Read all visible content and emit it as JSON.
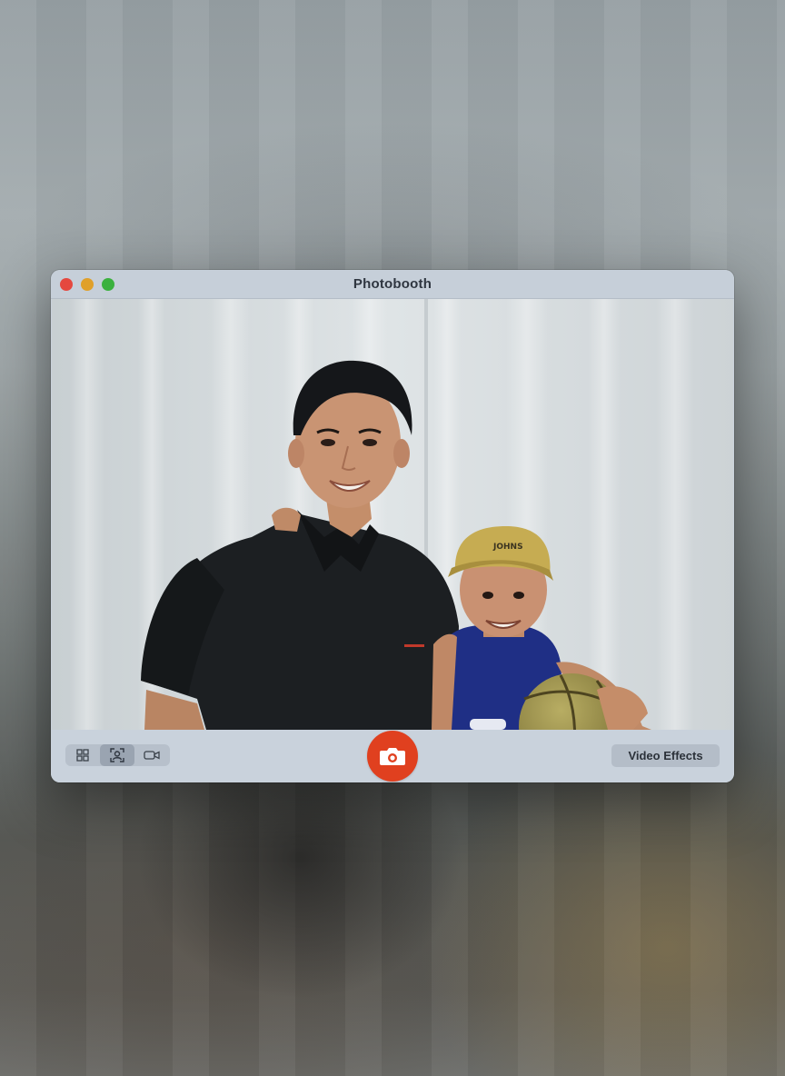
{
  "window": {
    "title": "Photobooth"
  },
  "traffic_lights": {
    "close_color": "#e5483f",
    "minimize_color": "#e0a02a",
    "maximize_color": "#3bb13e"
  },
  "toolbar": {
    "view_modes": [
      {
        "icon": "grid-icon",
        "active": false
      },
      {
        "icon": "portrait-icon",
        "active": true
      },
      {
        "icon": "video-camera-icon",
        "active": false
      }
    ],
    "shutter_icon": "camera-icon",
    "shutter_color": "#e0401f",
    "effects_label": "Video Effects"
  },
  "preview": {
    "cap_text": "JOHNS"
  }
}
